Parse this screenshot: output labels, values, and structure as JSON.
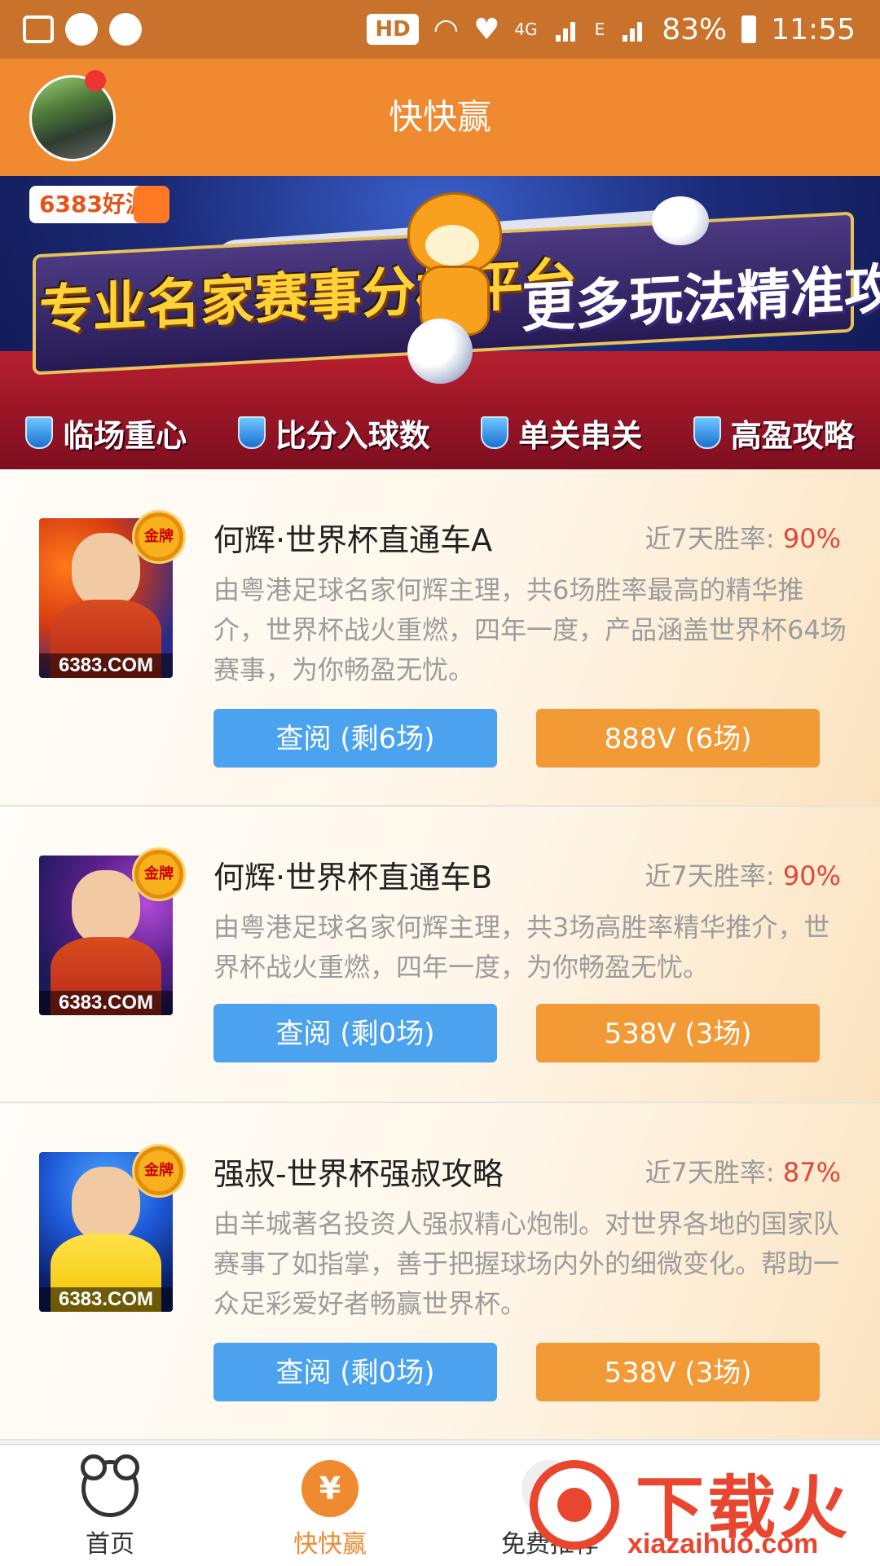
{
  "status_bar": {
    "hd": "HD",
    "net_4g": "4G",
    "net_e": "E",
    "battery": "83%",
    "time": "11:55"
  },
  "header": {
    "title": "快快赢"
  },
  "banner": {
    "logo": "6383好波",
    "headline_left": "专业名家赛事分析平台",
    "headline_right": "更多玩法精准攻略",
    "tags": [
      "临场重心",
      "比分入球数",
      "单关串关",
      "高盈攻略"
    ]
  },
  "products": [
    {
      "title": "何辉·世界杯直通车A",
      "rate_label": "近7天胜率:",
      "rate_value": "90%",
      "description": "由粤港足球名家何辉主理，共6场胜率最高的精华推介，世界杯战火重燃，四年一度，产品涵盖世界杯64场赛事，为你畅盈无忧。",
      "view_button": "查阅 (剩6场)",
      "price_button": "888V (6场)",
      "badge": "金牌",
      "photo_label": "6383.COM"
    },
    {
      "title": "何辉·世界杯直通车B",
      "rate_label": "近7天胜率:",
      "rate_value": "90%",
      "description": "由粤港足球名家何辉主理，共3场高胜率精华推介，世界杯战火重燃，四年一度，为你畅盈无忧。",
      "view_button": "查阅 (剩0场)",
      "price_button": "538V (3场)",
      "badge": "金牌",
      "photo_label": "6383.COM"
    },
    {
      "title": "强叔-世界杯强叔攻略",
      "rate_label": "近7天胜率:",
      "rate_value": "87%",
      "description": "由羊城著名投资人强叔精心炮制。对世界各地的国家队赛事了如指掌，善于把握球场内外的细微变化。帮助一众足彩爱好者畅赢世界杯。",
      "view_button": "查阅 (剩0场)",
      "price_button": "538V (3场)",
      "badge": "金牌",
      "photo_label": "6383.COM"
    }
  ],
  "tabs": [
    {
      "label": "首页",
      "icon": "bear-icon"
    },
    {
      "label": "快快赢",
      "icon": "yen-icon"
    },
    {
      "label": "免费推荐",
      "icon": "free-icon"
    }
  ],
  "watermark": {
    "brand": "下载火",
    "url": "xiazaihuo.com"
  },
  "colors": {
    "primary": "#f08a31",
    "status": "#c9722b",
    "blue": "#4ba2ee",
    "orange": "#f19a36",
    "rate": "#e0473a"
  }
}
